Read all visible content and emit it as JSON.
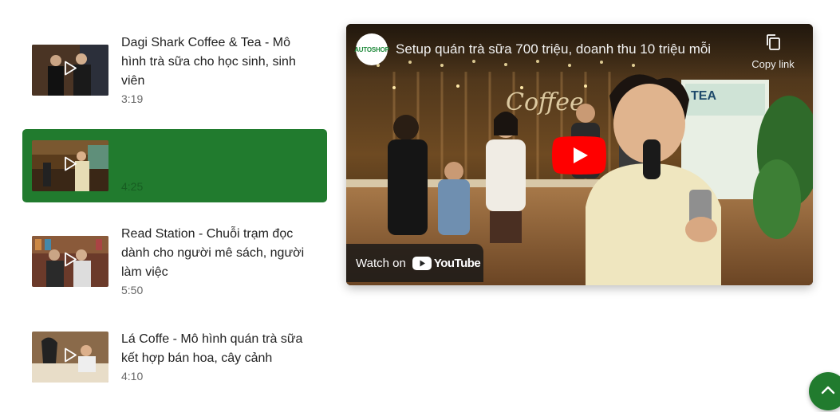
{
  "playlist": {
    "items": [
      {
        "title": "Dagi Shark Coffee & Tea - Mô hình trà sữa cho học sinh, sinh viên",
        "duration": "3:19",
        "active": false
      },
      {
        "title": "",
        "duration": "4:25",
        "active": true
      },
      {
        "title": "Read Station - Chuỗi trạm đọc dành cho người mê sách, người làm việc",
        "duration": "5:50",
        "active": false
      },
      {
        "title": "Lá Coffe - Mô hình quán trà sữa kết hợp bán hoa, cây cảnh",
        "duration": "4:10",
        "active": false
      }
    ]
  },
  "player": {
    "channel_logo": "AUTOSHOP",
    "video_title": "Setup quán trà sữa 700 triệu, doanh thu 10 triệu mỗi",
    "copy_link_label": "Copy link",
    "watch_on_label": "Watch on",
    "youtube_wordmark": "YouTube",
    "sign_text": "Coffee",
    "banner_text": "TEA"
  },
  "colors": {
    "accent": "#217b2e",
    "youtube_red": "#ff0000"
  },
  "icons": {
    "copy": "copy-icon",
    "play": "play-icon",
    "youtube": "youtube-icon",
    "back_to_top": "chevron-up-icon"
  }
}
